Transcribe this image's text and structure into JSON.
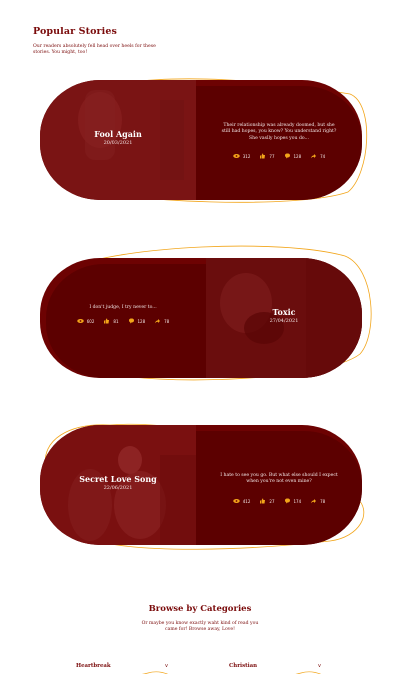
{
  "header": {
    "title": "Popular Stories",
    "subtitle": "Our readers absolutely fell head over heels for these stories. You might, too!"
  },
  "stories": [
    {
      "title": "Fool Again",
      "date": "20/03/2021",
      "excerpt": "Their relationship was already doomed, but she still had hopes, you know? You understand right? She vaslly hopes you do...",
      "stats": {
        "views": "312",
        "likes": "77",
        "comments": "128",
        "shares": "74"
      }
    },
    {
      "title": "Toxic",
      "date": "27/04/2021",
      "excerpt": "I don't judge, I try never to...",
      "stats": {
        "views": "602",
        "likes": "81",
        "comments": "128",
        "shares": "78"
      }
    },
    {
      "title": "Secret Love Song",
      "date": "22/06/2021",
      "excerpt": "I hate to see you go. But what else should I expect when you're not even mine?",
      "stats": {
        "views": "412",
        "likes": "27",
        "comments": "174",
        "shares": "78"
      }
    }
  ],
  "browse": {
    "title": "Browse by Categories",
    "subtitle": "Or maybe you know exactly waht kind of read you came for! Browse away, Love!"
  },
  "categories": [
    {
      "label": "Heartbreak",
      "chevron": "v"
    },
    {
      "label": "Christian",
      "chevron": "v"
    }
  ],
  "icons": {
    "views": "eye-icon",
    "likes": "thumbs-up-icon",
    "comments": "comment-icon",
    "shares": "share-arrow-icon"
  },
  "colors": {
    "primary": "#6d0202",
    "accent": "#f2a51a",
    "text_light": "#f2e6e6"
  }
}
